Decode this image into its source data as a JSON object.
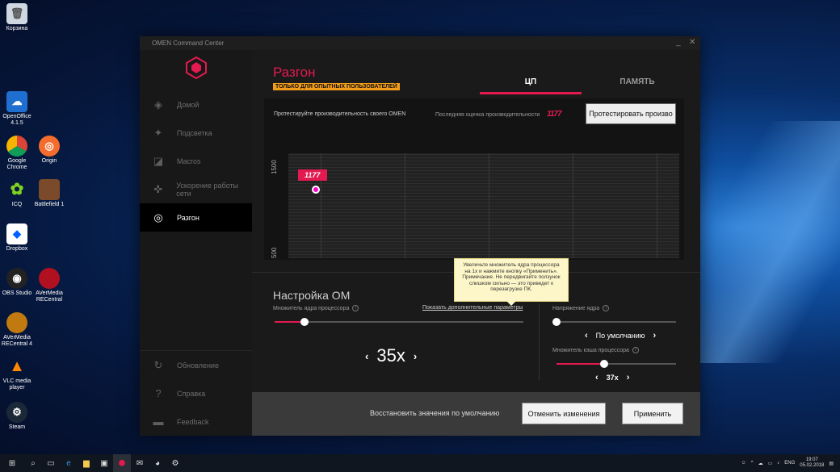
{
  "desktop": {
    "icons": [
      {
        "label": "Корзина",
        "icon": "recycle-bin-icon"
      },
      {
        "label": "OpenOffice 4.1.5",
        "icon": "openoffice-icon"
      },
      {
        "label": "Google Chrome",
        "icon": "chrome-icon"
      },
      {
        "label": "Origin",
        "icon": "origin-icon"
      },
      {
        "label": "ICQ",
        "icon": "icq-icon"
      },
      {
        "label": "Battlefield 1",
        "icon": "battlefield-icon"
      },
      {
        "label": "Dropbox",
        "icon": "dropbox-icon"
      },
      {
        "label": "OBS Studio",
        "icon": "obs-icon"
      },
      {
        "label": "AVerMedia RECentral",
        "icon": "avermedia-icon"
      },
      {
        "label": "AVerMedia RECentral 4",
        "icon": "avermedia4-icon"
      },
      {
        "label": "VLC media player",
        "icon": "vlc-icon"
      },
      {
        "label": "Steam",
        "icon": "steam-icon"
      }
    ]
  },
  "window": {
    "title": "OMEN Command Center",
    "minimize": "_",
    "close": "✕"
  },
  "sidebar": {
    "items": [
      {
        "label": "Домой",
        "icon": "home-icon"
      },
      {
        "label": "Подсветка",
        "icon": "lighting-icon"
      },
      {
        "label": "Macros",
        "icon": "macros-icon"
      },
      {
        "label": "Ускорение работы сети",
        "icon": "network-icon"
      },
      {
        "label": "Разгон",
        "icon": "overclock-icon",
        "active": true
      }
    ],
    "bottom": [
      {
        "label": "Обновление",
        "icon": "update-icon"
      },
      {
        "label": "Справка",
        "icon": "help-icon"
      },
      {
        "label": "Feedback",
        "icon": "feedback-icon"
      }
    ]
  },
  "main": {
    "title": "Разгон",
    "badge": "ТОЛЬКО ДЛЯ ОПЫТНЫХ ПОЛЬЗОВАТЕЛЕЙ",
    "tabs": [
      {
        "label": "ЦП",
        "active": true
      },
      {
        "label": "ПАМЯТЬ",
        "active": false
      }
    ],
    "bench": {
      "prompt": "Протестируйте производительность своего OMEN",
      "last_score_label": "Последняя оценка производительности",
      "last_score_value": "1177",
      "test_button": "Протестировать произво"
    },
    "chart": {
      "y_top": "1500",
      "y_bottom": "500",
      "point_label": "1177"
    },
    "tooltip": "Увеличьте множитель ядра процессора на 1x и нажмите кнопку «Применить». Примечание. Не передвигайте ползунок слишком сильно — это приведет к перезагрузке ПК."
  },
  "settings": {
    "title": "Настройка OM",
    "multiplier_label": "Множитель ядра процессора",
    "more_link": "Показать дополнительные параметры",
    "multiplier_value": "35x",
    "multiplier_fraction": 0.12,
    "voltage_label": "Напряжение ядра",
    "voltage_value": "По умолчанию",
    "voltage_fraction": 0.0,
    "cache_label": "Множитель кэша процессора",
    "cache_value": "37x",
    "cache_fraction": 0.4
  },
  "footer": {
    "restore": "Восстановить значения по умолчанию",
    "cancel": "Отменить изменения",
    "apply": "Применить"
  },
  "taskbar": {
    "lang": "ENG",
    "time": "19:07",
    "date": "05.02.2018"
  },
  "colors": {
    "accent": "#e21a4f",
    "badge": "#f39c1a"
  }
}
